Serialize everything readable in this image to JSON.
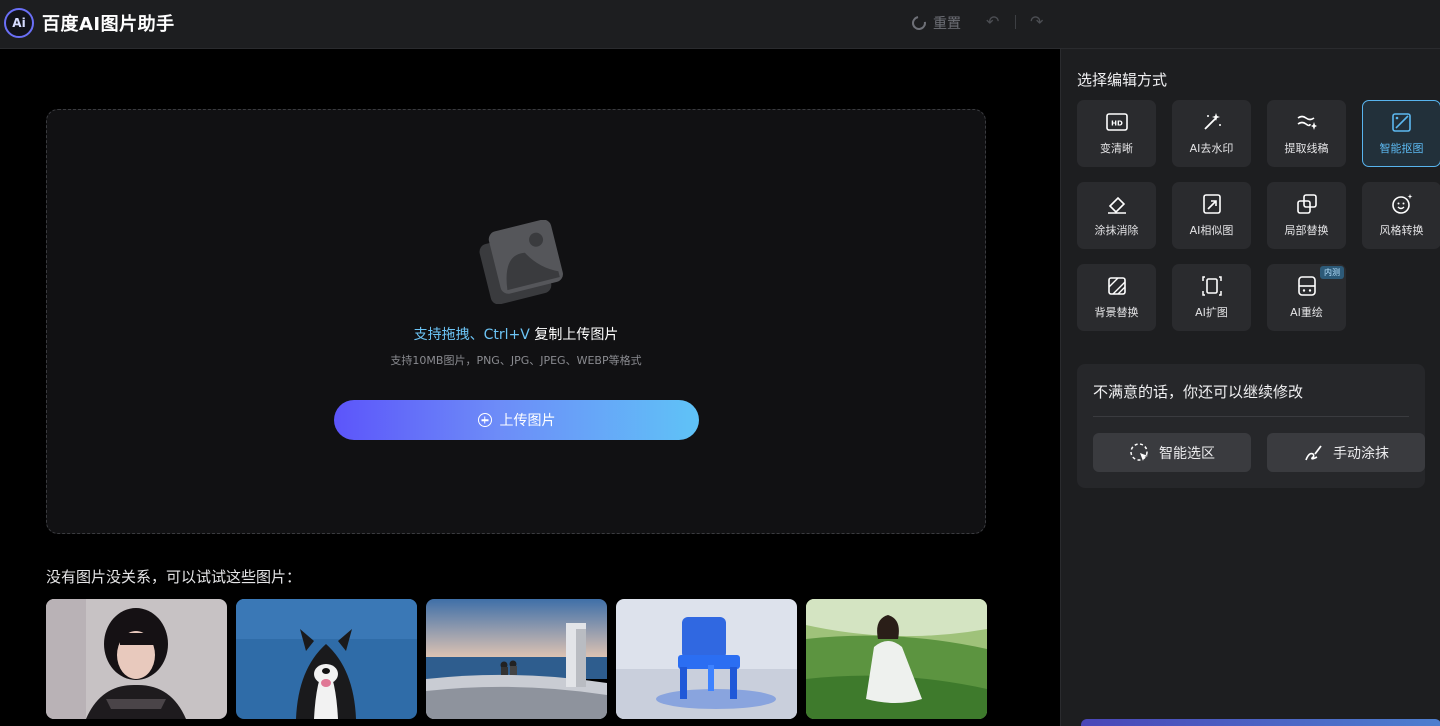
{
  "header": {
    "logo_text": "Ai",
    "title": "百度AI图片助手",
    "reset_label": "重置",
    "undo_icon": "undo-icon",
    "redo_icon": "redo-icon"
  },
  "upload": {
    "hint_highlight": "支持拖拽、Ctrl+V",
    "hint_rest": "复制上传图片",
    "formats": "支持10MB图片，PNG、JPG、JPEG、WEBP等格式",
    "button_label": "上传图片"
  },
  "samples": {
    "title": "没有图片没关系，可以试试这些图片：",
    "items": [
      {
        "name": "portrait"
      },
      {
        "name": "dog"
      },
      {
        "name": "seaside-terrace"
      },
      {
        "name": "blue-chair"
      },
      {
        "name": "grassland-girl"
      }
    ]
  },
  "sidebar": {
    "title": "选择编辑方式",
    "tools": [
      {
        "label": "变清晰",
        "icon": "hd-icon"
      },
      {
        "label": "AI去水印",
        "icon": "magic-wand-icon"
      },
      {
        "label": "提取线稿",
        "icon": "line-draft-icon"
      },
      {
        "label": "智能抠图",
        "icon": "cutout-icon",
        "active": true
      },
      {
        "label": "涂抹消除",
        "icon": "eraser-icon"
      },
      {
        "label": "AI相似图",
        "icon": "similar-image-icon"
      },
      {
        "label": "局部替换",
        "icon": "partial-replace-icon"
      },
      {
        "label": "风格转换",
        "icon": "style-face-icon"
      },
      {
        "label": "背景替换",
        "icon": "background-replace-icon"
      },
      {
        "label": "AI扩图",
        "icon": "expand-icon"
      },
      {
        "label": "AI重绘",
        "icon": "redraw-icon",
        "badge": "内测"
      }
    ],
    "panel": {
      "title": "不满意的话，你还可以继续修改",
      "smart_select_label": "智能选区",
      "manual_brush_label": "手动涂抹"
    }
  },
  "colors": {
    "accent": "#5cb8f0",
    "button_gradient_start": "#5c55fa",
    "button_gradient_end": "#5fc3f7"
  }
}
